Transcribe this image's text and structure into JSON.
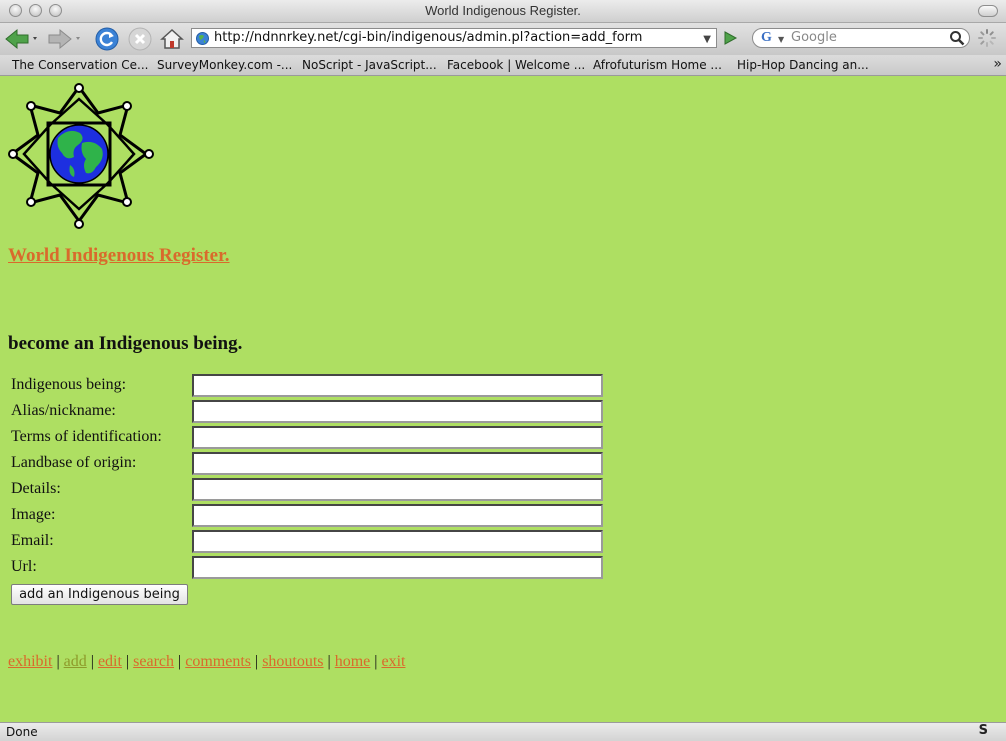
{
  "window": {
    "title": "World Indigenous Register."
  },
  "toolbar": {
    "url": "http://ndnnrkey.net/cgi-bin/indigenous/admin.pl?action=add_form",
    "search_placeholder": "Google"
  },
  "bookmarks": [
    "The Conservation Ce...",
    "SurveyMonkey.com -...",
    "NoScript - JavaScript...",
    "Facebook | Welcome ...",
    "Afrofuturism Home ...",
    "Hip-Hop Dancing an..."
  ],
  "page": {
    "site_title": "World Indigenous Register.",
    "form_heading": "become an Indigenous being.",
    "fields": [
      {
        "label": "Indigenous being:",
        "value": ""
      },
      {
        "label": "Alias/nickname:",
        "value": ""
      },
      {
        "label": "Terms of identification:",
        "value": ""
      },
      {
        "label": "Landbase of origin:",
        "value": ""
      },
      {
        "label": "Details:",
        "value": ""
      },
      {
        "label": "Image:",
        "value": ""
      },
      {
        "label": "Email:",
        "value": ""
      },
      {
        "label": "Url:",
        "value": ""
      }
    ],
    "submit_label": "add an Indigenous being",
    "nav": [
      "exhibit",
      "add",
      "edit",
      "search",
      "comments",
      "shoutouts",
      "home",
      "exit"
    ]
  },
  "status": {
    "text": "Done",
    "icon": "S"
  },
  "colors": {
    "page_bg": "#aedf62",
    "link": "#d96a2c",
    "visited_link": "#8e9a2b"
  }
}
